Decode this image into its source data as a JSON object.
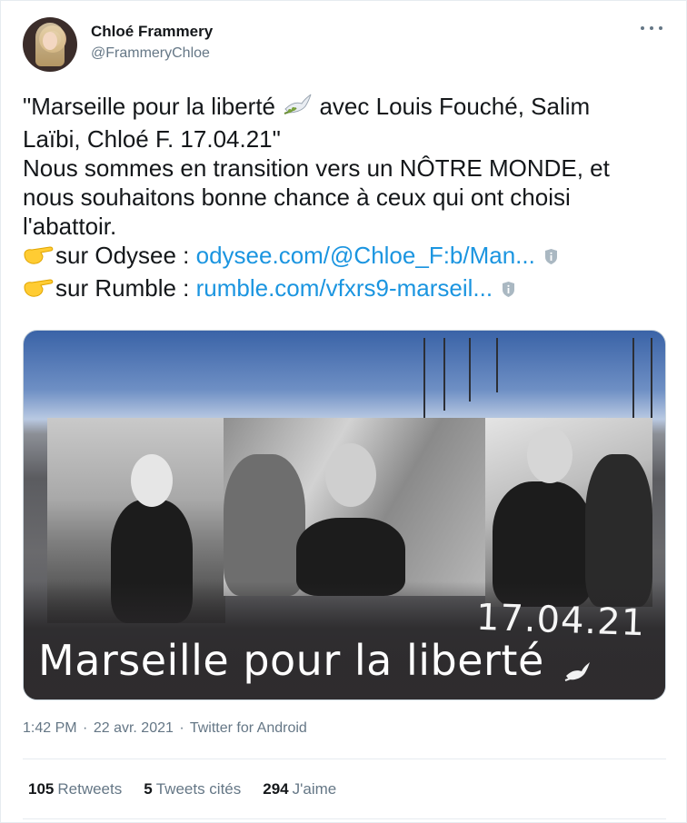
{
  "author": {
    "display_name": "Chloé Frammery",
    "handle": "@FrammeryChloe"
  },
  "tweet": {
    "line1_a": "\"Marseille pour la liberté ",
    "line1_b": " avec Louis Fouché, Salim",
    "line2": "Laïbi, Chloé F. 17.04.21\"",
    "line3": "Nous sommes en transition vers un NÔTRE MONDE, et",
    "line4": "nous souhaitons bonne chance à ceux qui ont choisi",
    "line5": "l'abattoir.",
    "odysee_prefix": "sur Odysee : ",
    "odysee_link": "odysee.com/@Chloe_F:b/Man...",
    "rumble_prefix": "sur Rumble : ",
    "rumble_link": "rumble.com/vfxrs9-marseil..."
  },
  "media": {
    "date_text": "17.04.21",
    "title_text": "Marseille pour la liberté"
  },
  "meta": {
    "time": "1:42 PM",
    "date": "22 avr. 2021",
    "source": "Twitter for Android",
    "separator": "·"
  },
  "stats": {
    "retweets_count": "105",
    "retweets_label": "Retweets",
    "quotes_count": "5",
    "quotes_label": "Tweets cités",
    "likes_count": "294",
    "likes_label": "J'aime"
  },
  "icons": {
    "dove": "dove-icon",
    "pointing_hand": "pointing-right-hand-icon",
    "info": "info-shield-icon",
    "more": "more-options-icon"
  },
  "colors": {
    "link": "#1b95e0",
    "secondary_text": "#657786",
    "primary_text": "#14171a"
  }
}
